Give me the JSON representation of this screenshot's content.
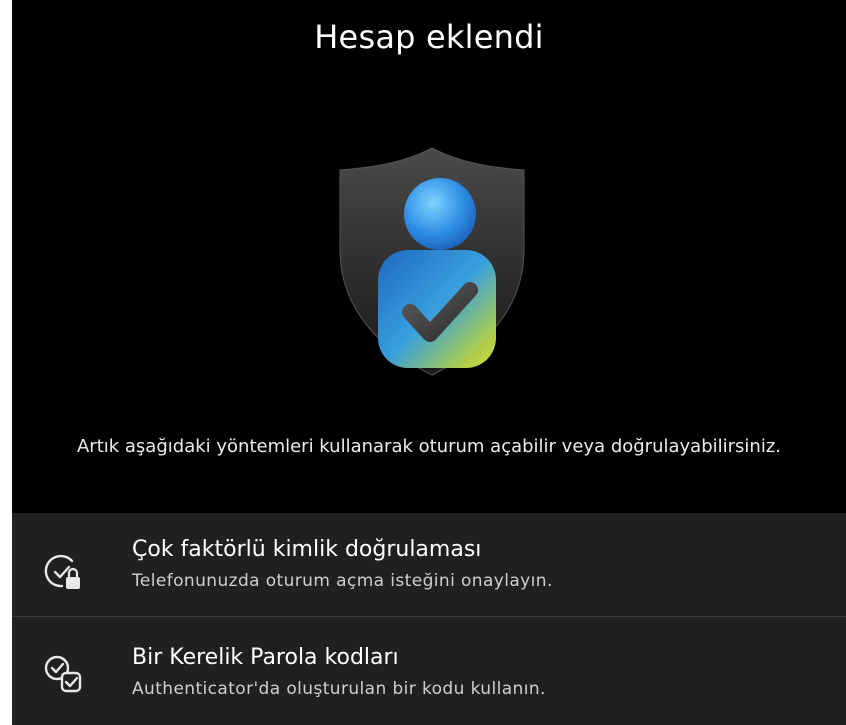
{
  "header": {
    "title": "Hesap eklendi"
  },
  "hero": {
    "icon": "shield-user-check-icon"
  },
  "description": "Artık aşağıdaki yöntemleri kullanarak oturum açabilir veya doğrulayabilirsiniz.",
  "options": [
    {
      "title": "Çok faktörlü kimlik doğrulaması",
      "subtitle": "Telefonunuzda oturum açma isteğini onaylayın.",
      "icon": "check-lock-icon"
    },
    {
      "title": "Bir Kerelik Parola kodları",
      "subtitle": "Authenticator'da oluşturulan bir kodu kullanın.",
      "icon": "double-check-icon"
    }
  ],
  "colors": {
    "background": "#000000",
    "panel": "#202020",
    "accent": "#3a8ee6"
  }
}
